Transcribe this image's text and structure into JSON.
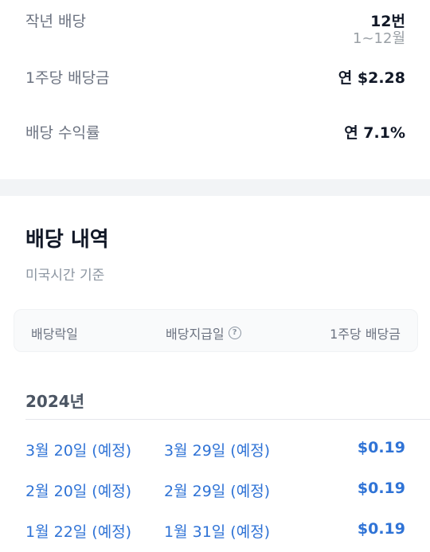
{
  "summary": {
    "last_year_label": "작년 배당",
    "last_year_count": "12번",
    "last_year_range": "1~12월",
    "per_share_label": "1주당 배당금",
    "per_share_value": "연 $2.28",
    "yield_label": "배당 수익률",
    "yield_value": "연 7.1%"
  },
  "history": {
    "title": "배당 내역",
    "subtitle": "미국시간 기준",
    "columns": {
      "ex_date": "배당락일",
      "pay_date": "배당지급일",
      "amount": "1주당 배당금"
    },
    "year": "2024년",
    "rows": [
      {
        "ex_date": "3월 20일 (예정)",
        "pay_date": "3월 29일 (예정)",
        "amount": "$0.19"
      },
      {
        "ex_date": "2월 20일 (예정)",
        "pay_date": "2월 29일 (예정)",
        "amount": "$0.19"
      },
      {
        "ex_date": "1월 22일 (예정)",
        "pay_date": "1월 31일 (예정)",
        "amount": "$0.19"
      }
    ]
  }
}
